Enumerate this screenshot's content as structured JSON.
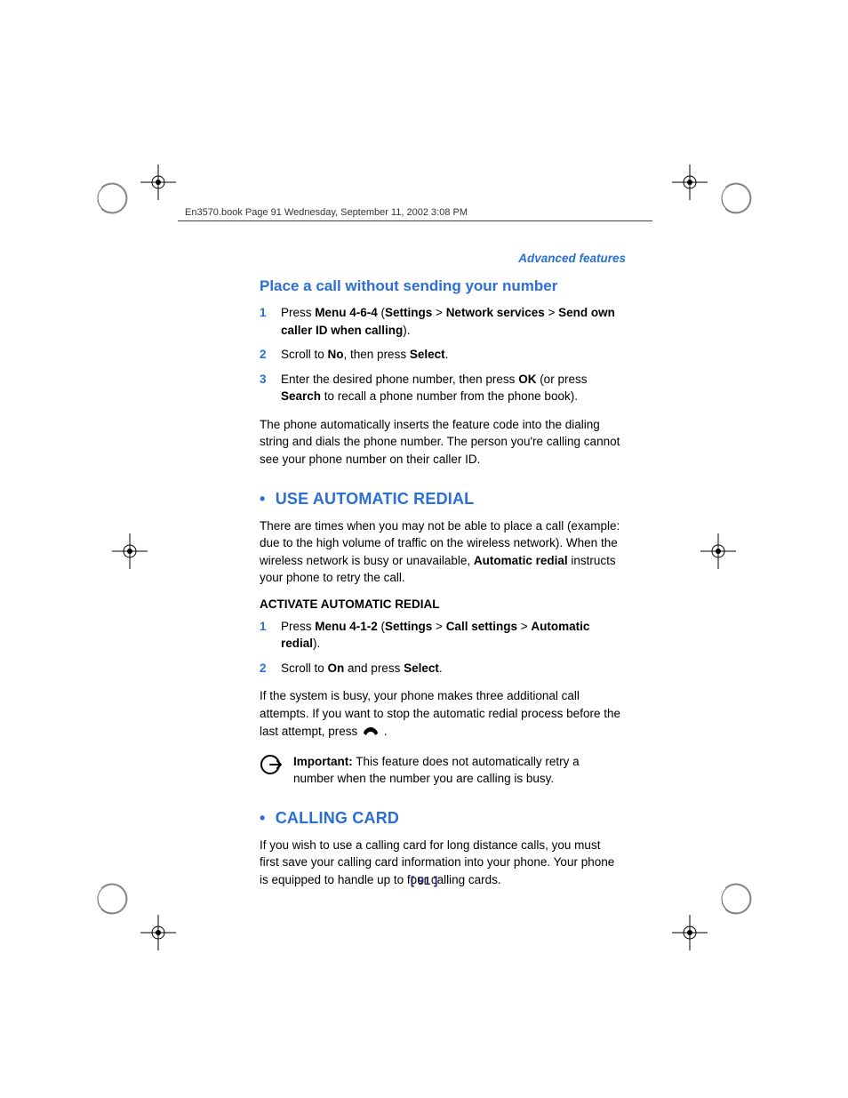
{
  "header": {
    "running": "En3570.book  Page 91  Wednesday, September 11, 2002  3:08 PM"
  },
  "section_label": "Advanced features",
  "sub_heading": "Place a call without sending your number",
  "steps1": {
    "n1": "1",
    "s1a": "Press ",
    "s1b": "Menu 4-6-4",
    "s1c": " (",
    "s1d": "Settings",
    "s1e": " > ",
    "s1f": "Network services",
    "s1g": " > ",
    "s1h": "Send own caller ID when calling",
    "s1i": ").",
    "n2": "2",
    "s2a": "Scroll to ",
    "s2b": "No",
    "s2c": ", then press ",
    "s2d": "Select",
    "s2e": ".",
    "n3": "3",
    "s3a": "Enter the desired phone number, then press ",
    "s3b": "OK",
    "s3c": " (or press ",
    "s3d": "Search",
    "s3e": " to recall a phone number from the phone book)."
  },
  "para1": "The phone automatically inserts the feature code into the dialing string and dials the phone number. The person you're calling cannot see your phone number on their caller ID.",
  "major1": "USE AUTOMATIC REDIAL",
  "para2a": "There are times when you may not be able to place a call (example: due to the high volume of traffic on the wireless network). When the wireless network is busy or unavailable, ",
  "para2b": "Automatic redial",
  "para2c": " instructs your phone to retry the call.",
  "subhead2": "ACTIVATE AUTOMATIC REDIAL",
  "steps2": {
    "n1": "1",
    "s1a": "Press ",
    "s1b": "Menu 4-1-2",
    "s1c": " (",
    "s1d": "Settings",
    "s1e": " > ",
    "s1f": "Call settings",
    "s1g": " > ",
    "s1h": "Automatic redial",
    "s1i": ").",
    "n2": "2",
    "s2a": "Scroll to ",
    "s2b": "On",
    "s2c": " and press ",
    "s2d": "Select",
    "s2e": "."
  },
  "para3a": "If the system is busy, your phone makes three additional call attempts. If you want to stop the automatic redial process before the last attempt, press ",
  "para3b": " .",
  "note": {
    "label": "Important:",
    "text": " This feature does not automatically retry a number when the number you are calling is busy."
  },
  "major2": "CALLING CARD",
  "para4": "If you wish to use a calling card for long distance calls, you must first save your calling card information into your phone. Your phone is equipped to handle up to four calling cards.",
  "page_number": "[ 91 ]",
  "bullet": " • "
}
